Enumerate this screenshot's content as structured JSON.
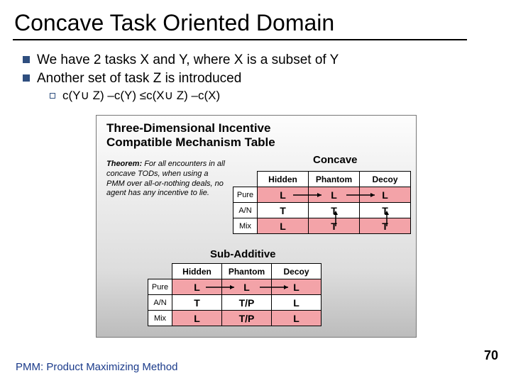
{
  "title": "Concave Task Oriented Domain",
  "bullets": [
    "We have 2 tasks X and Y, where X is a subset of Y",
    "Another set of task Z is introduced"
  ],
  "sub_bullet": "c(Y∪ Z) –c(Y) ≤c(X∪ Z) –c(X)",
  "figure": {
    "title_line1": "Three-Dimensional Incentive",
    "title_line2": "Compatible Mechanism Table",
    "theorem_label": "Theorem:",
    "theorem_text": "For all encounters in all concave TODs, when using a PMM over all-or-nothing deals, no agent has any incentive to lie.",
    "concave_label": "Concave",
    "subadd_label": "Sub-Additive"
  },
  "concave_table": {
    "cols": [
      "Hidden",
      "Phantom",
      "Decoy"
    ],
    "rows": [
      {
        "hdr": "Pure",
        "cells": [
          "L",
          "L",
          "L"
        ],
        "pink": true
      },
      {
        "hdr": "A/N",
        "cells": [
          "T",
          "T",
          "T"
        ],
        "pink": false
      },
      {
        "hdr": "Mix",
        "cells": [
          "L",
          "T",
          "T"
        ],
        "pink": true
      }
    ]
  },
  "subadd_table": {
    "cols": [
      "Hidden",
      "Phantom",
      "Decoy"
    ],
    "rows": [
      {
        "hdr": "Pure",
        "cells": [
          "L",
          "L",
          "L"
        ],
        "pink": true
      },
      {
        "hdr": "A/N",
        "cells": [
          "T",
          "T/P",
          "L"
        ],
        "pink": false
      },
      {
        "hdr": "Mix",
        "cells": [
          "L",
          "T/P",
          "L"
        ],
        "pink": true
      }
    ]
  },
  "footer": "PMM: Product Maximizing Method",
  "page_number": "70"
}
